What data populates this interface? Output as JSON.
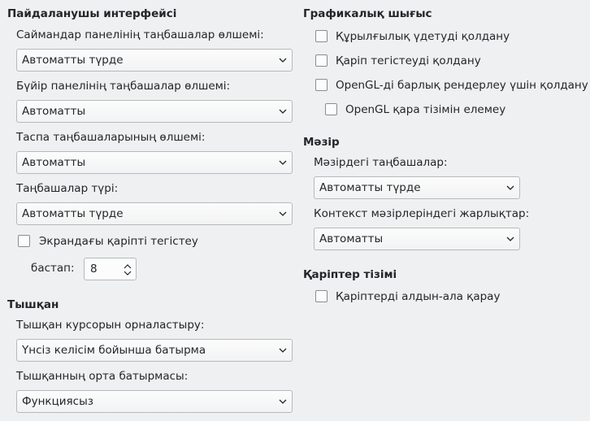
{
  "ui": {
    "title": "Пайдаланушы интерфейсі",
    "sidebar_icon_size_label": "Саймандар панелінің таңбашалар өлшемі:",
    "sidebar_icon_size_value": "Автоматты түрде",
    "side_panel_icon_size_label": "Бүйір панелінің таңбашалар өлшемі:",
    "side_panel_icon_size_value": "Автоматты",
    "notebookbar_icon_size_label": "Таспа таңбашаларының өлшемі:",
    "notebookbar_icon_size_value": "Автоматты",
    "icon_style_label": "Таңбашалар түрі:",
    "icon_style_value": "Автоматты түрде",
    "screen_font_aa_label": "Экрандағы қаріпті тегістеу",
    "from_label": "бастап:",
    "from_value": "8"
  },
  "mouse": {
    "title": "Тышқан",
    "positioning_label": "Тышқан курсорын орналастыру:",
    "positioning_value": "Үнсіз келісім бойынша батырма",
    "middle_button_label": "Тышқанның орта батырмасы:",
    "middle_button_value": "Функциясыз"
  },
  "graphics": {
    "title": "Графикалық шығыс",
    "hw_accel_label": "Құрылғылық үдетуді қолдану",
    "aa_label": "Қаріп тегістеуді қолдану",
    "opengl_label": "OpenGL-ді барлық рендерлеу үшін қолдану",
    "opengl_blacklist_label": "OpenGL қара тізімін елемеу"
  },
  "menu": {
    "title": "Мәзір",
    "icons_label": "Мәзірдегі таңбашалар:",
    "icons_value": "Автоматты түрде",
    "shortcuts_label": "Контекст мәзірлеріндегі жарлықтар:",
    "shortcuts_value": "Автоматты"
  },
  "fontlist": {
    "title": "Қаріптер тізімі",
    "preview_label": "Қаріптерді алдын-ала қарау"
  }
}
